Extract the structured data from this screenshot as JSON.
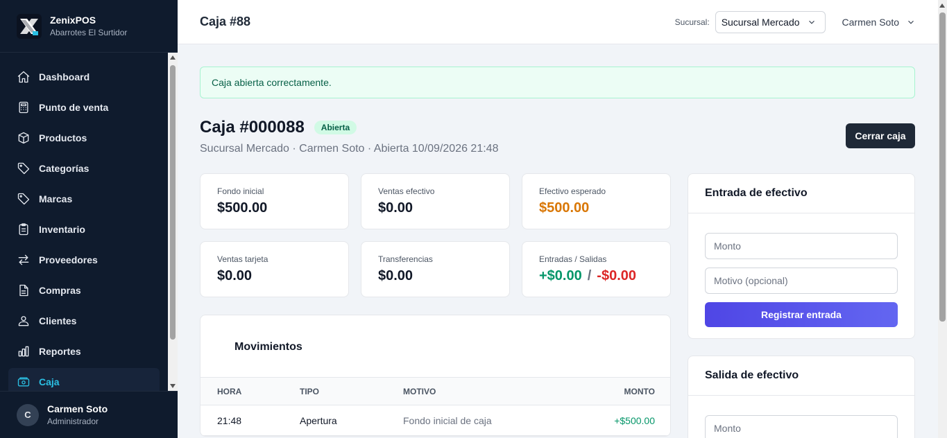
{
  "brand": {
    "name": "ZenixPOS",
    "subtitle": "Abarrotes El Surtidor"
  },
  "sidebar": {
    "items": [
      {
        "label": "Dashboard",
        "icon": "home-icon"
      },
      {
        "label": "Punto de venta",
        "icon": "calculator-icon"
      },
      {
        "label": "Productos",
        "icon": "box-icon"
      },
      {
        "label": "Categorías",
        "icon": "tag-icon"
      },
      {
        "label": "Marcas",
        "icon": "tag-icon"
      },
      {
        "label": "Inventario",
        "icon": "clipboard-icon"
      },
      {
        "label": "Proveedores",
        "icon": "swap-icon"
      },
      {
        "label": "Compras",
        "icon": "document-icon"
      },
      {
        "label": "Clientes",
        "icon": "users-icon"
      },
      {
        "label": "Reportes",
        "icon": "bar-chart-icon"
      },
      {
        "label": "Caja",
        "icon": "cash-register-icon",
        "active": true
      }
    ],
    "user": {
      "initial": "C",
      "name": "Carmen Soto",
      "role": "Administrador"
    }
  },
  "topbar": {
    "title": "Caja #88",
    "sucursal_label": "Sucursal:",
    "sucursal_value": "Sucursal Mercado",
    "user_name": "Carmen Soto"
  },
  "alert": {
    "text": "Caja abierta correctamente."
  },
  "caja": {
    "title": "Caja #000088",
    "status": "Abierta",
    "subtitle": "Sucursal Mercado · Carmen Soto · Abierta 10/09/2026 21:48",
    "close_button": "Cerrar caja"
  },
  "stats": {
    "fondo_inicial": {
      "label": "Fondo inicial",
      "value": "$500.00"
    },
    "ventas_efectivo": {
      "label": "Ventas efectivo",
      "value": "$0.00"
    },
    "efectivo_esperado": {
      "label": "Efectivo esperado",
      "value": "$500.00"
    },
    "ventas_tarjeta": {
      "label": "Ventas tarjeta",
      "value": "$0.00"
    },
    "transferencias": {
      "label": "Transferencias",
      "value": "$0.00"
    },
    "entradas_salidas": {
      "label": "Entradas / Salidas",
      "entradas": "+$0.00",
      "separator": "/",
      "salidas": "-$0.00"
    }
  },
  "colors": {
    "expected": "#d97706",
    "positive": "#059669",
    "negative": "#dc2626",
    "accent": "#4f46e5",
    "active_nav": "#2bc0e4"
  },
  "movimientos": {
    "title": "Movimientos",
    "headers": {
      "hora": "HORA",
      "tipo": "TIPO",
      "motivo": "MOTIVO",
      "monto": "MONTO"
    },
    "rows": [
      {
        "hora": "21:48",
        "tipo": "Apertura",
        "motivo": "Fondo inicial de caja",
        "monto": "+$500.00"
      }
    ]
  },
  "entrada": {
    "title": "Entrada de efectivo",
    "monto_placeholder": "Monto",
    "motivo_placeholder": "Motivo (opcional)",
    "button": "Registrar entrada"
  },
  "salida": {
    "title": "Salida de efectivo",
    "monto_placeholder": "Monto"
  }
}
